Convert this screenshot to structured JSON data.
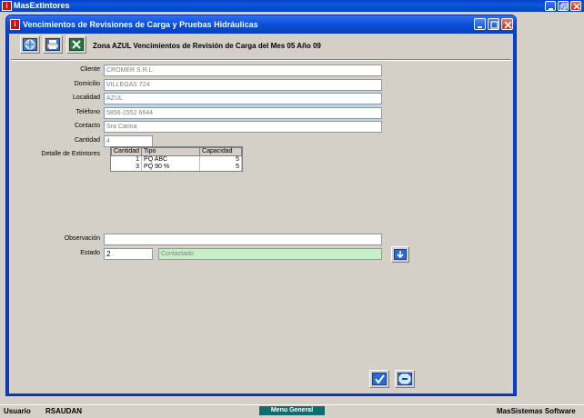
{
  "app": {
    "title": "MasExtintores"
  },
  "window": {
    "title": "Vencimientos de Revisiones de Carga y Pruebas Hidráulicas"
  },
  "toolbar": {
    "zone_title": "Zona AZUL Vencimientos de Revisión de Carga del Mes 05 Año 09"
  },
  "form": {
    "cliente_label": "Cliente",
    "cliente_value": "CROMER S.R.L.",
    "domicilio_label": "Domicilio",
    "domicilio_value": "VILLEGAS 724",
    "localidad_label": "Localidad",
    "localidad_value": "AZUL",
    "telefono_label": "Teléfono",
    "telefono_value": "5856-1552 6644",
    "contacto_label": "Contacto",
    "contacto_value": "Sra Carina",
    "cantidad_label": "Cantidad",
    "cantidad_value": "4",
    "detalle_label": "Detalle de Extintores",
    "observacion_label": "Observación",
    "observacion_value": "",
    "estado_label": "Estado",
    "estado_code": "2",
    "estado_text": "Contactado"
  },
  "grid": {
    "headers": [
      "Cantidad",
      "Tipo",
      "Capacidad"
    ],
    "rows": [
      {
        "cantidad": "1",
        "tipo": "PQ ABC",
        "capacidad": "5"
      },
      {
        "cantidad": "3",
        "tipo": "PQ 90 %",
        "capacidad": "5"
      }
    ]
  },
  "statusbar": {
    "usuario_label": "Usuario",
    "usuario_value": "RSAUDAN",
    "menu_general": "Menu General",
    "brand": "MasSistemas Software"
  },
  "colors": {
    "titlebar": "#0a4fd8",
    "accent_green": "#c8f0c8",
    "menu_teal": "#0c6e70"
  }
}
